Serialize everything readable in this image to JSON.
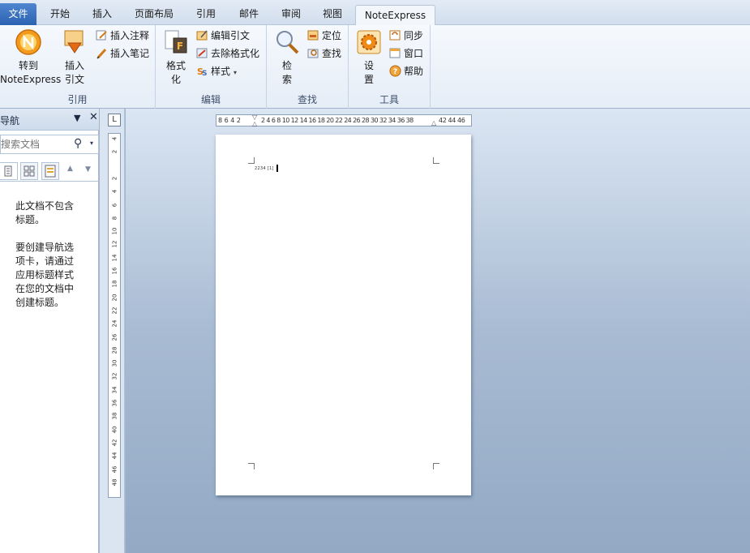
{
  "tabs": [
    {
      "label": "文件"
    },
    {
      "label": "开始"
    },
    {
      "label": "插入"
    },
    {
      "label": "页面布局"
    },
    {
      "label": "引用"
    },
    {
      "label": "邮件"
    },
    {
      "label": "审阅"
    },
    {
      "label": "视图"
    },
    {
      "label": "NoteExpress"
    }
  ],
  "active_tab": "NoteExpress",
  "ribbon": {
    "cite": {
      "label": "引用",
      "goto_line1": "转到",
      "goto_line2": "NoteExpress",
      "insert_line1": "插入",
      "insert_line2": "引文",
      "insert_note": "插入注释",
      "insert_notes": "插入笔记"
    },
    "edit": {
      "label": "编辑",
      "format_line1": "格式",
      "format_line2": "化",
      "edit_citation": "编辑引文",
      "remove_format": "去除格式化",
      "style": "样式"
    },
    "find": {
      "label": "查找",
      "search_line1": "检",
      "search_line2": "索",
      "locate": "定位",
      "find": "查找"
    },
    "tools": {
      "label": "工具",
      "settings_line1": "设",
      "settings_line2": "置",
      "sync": "同步",
      "window": "窗口",
      "help": "帮助"
    }
  },
  "nav": {
    "title": "导航",
    "search_placeholder": "搜索文档",
    "msg1": "此文档不包含标题。",
    "msg2": "要创建导航选项卡，请通过应用标题样式在您的文档中创建标题。"
  },
  "ruler": {
    "corner": "L",
    "h_left": "8 6 4 2",
    "h_right": "2 4 6 8 10 12 14 16 18 20 22 24 26 28 30 32 34 36 38",
    "h_far": "42 44 46",
    "v_marks": [
      "4",
      "2",
      "",
      "2",
      "4",
      "6",
      "8",
      "10",
      "12",
      "14",
      "16",
      "18",
      "20",
      "22",
      "24",
      "26",
      "28",
      "30",
      "32",
      "34",
      "36",
      "38",
      "40",
      "42",
      "44",
      "46",
      "48"
    ]
  },
  "document": {
    "text": "2234 [1]"
  },
  "colors": {
    "file_tab": "#2b62b2",
    "workspace": "#a8bbd3",
    "ribbon": "#eaf0f8"
  }
}
